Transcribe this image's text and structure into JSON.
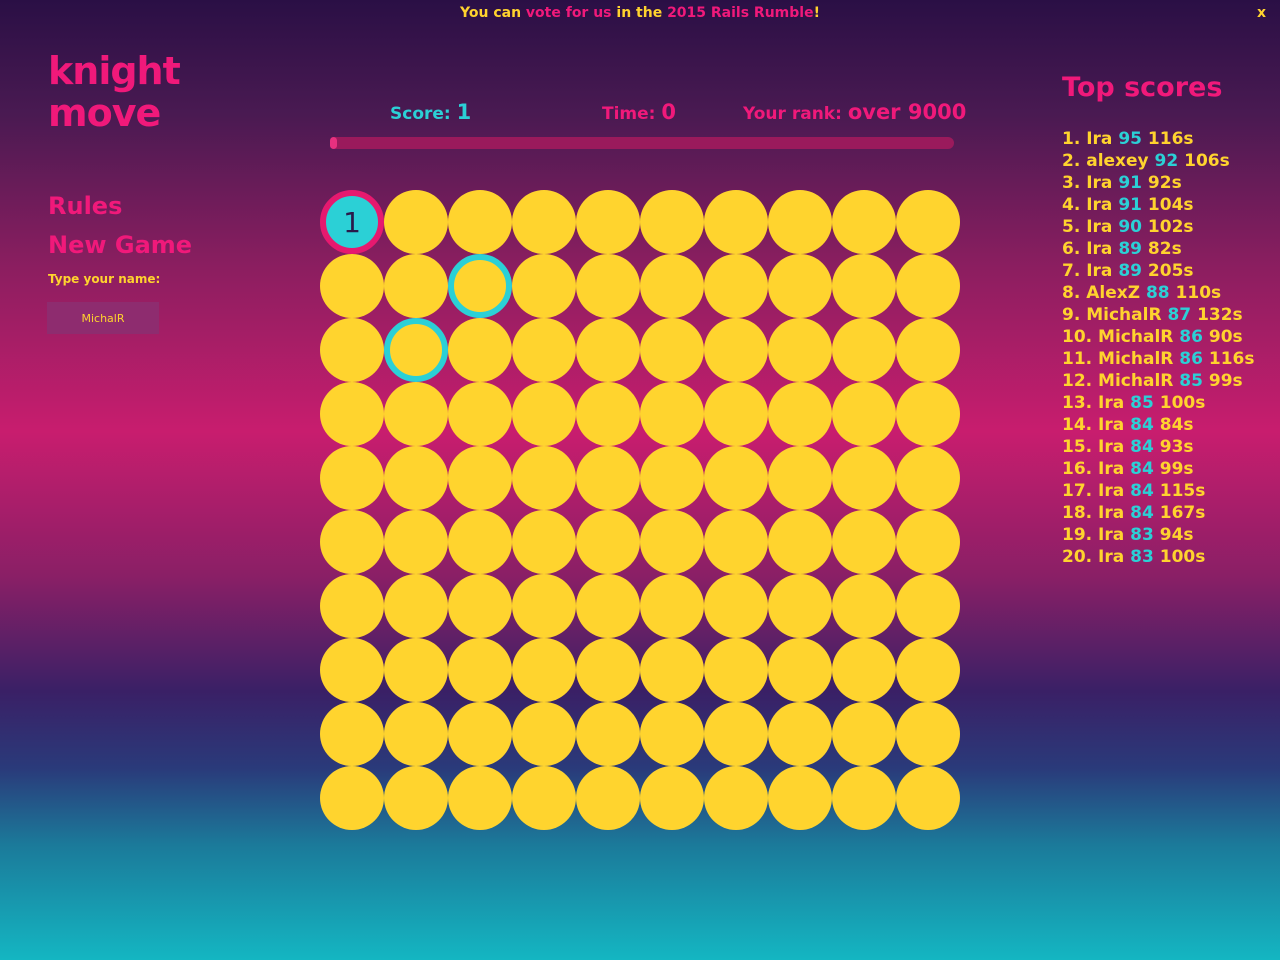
{
  "banner": {
    "part1": "You can ",
    "link1": "vote for us",
    "part2": " in the ",
    "link2": "2015 Rails Rumble",
    "part3": "!",
    "close": "x"
  },
  "logo": {
    "line1": "knight",
    "line2": "move"
  },
  "menu": {
    "rules": "Rules",
    "new_game": "New Game",
    "name_label": "Type your name:",
    "name_value": "MichalR"
  },
  "stats": {
    "score_label": "Score: ",
    "score_value": "1",
    "time_label": "Time: ",
    "time_value": "0",
    "rank_label": "Your rank: ",
    "rank_value": "over 9000",
    "progress_percent": 1
  },
  "board": {
    "size": 10,
    "current": {
      "row": 0,
      "col": 0,
      "label": "1"
    },
    "available": [
      {
        "row": 1,
        "col": 2
      },
      {
        "row": 2,
        "col": 1
      }
    ]
  },
  "top_scores": {
    "title": "Top scores",
    "entries": [
      {
        "rank": "1.",
        "name": "Ira",
        "score": "95",
        "time": "116s"
      },
      {
        "rank": "2.",
        "name": "alexey",
        "score": "92",
        "time": "106s"
      },
      {
        "rank": "3.",
        "name": "Ira",
        "score": "91",
        "time": "92s"
      },
      {
        "rank": "4.",
        "name": "Ira",
        "score": "91",
        "time": "104s"
      },
      {
        "rank": "5.",
        "name": "Ira",
        "score": "90",
        "time": "102s"
      },
      {
        "rank": "6.",
        "name": "Ira",
        "score": "89",
        "time": "82s"
      },
      {
        "rank": "7.",
        "name": "Ira",
        "score": "89",
        "time": "205s"
      },
      {
        "rank": "8.",
        "name": "AlexZ",
        "score": "88",
        "time": "110s"
      },
      {
        "rank": "9.",
        "name": "MichalR",
        "score": "87",
        "time": "132s"
      },
      {
        "rank": "10.",
        "name": "MichalR",
        "score": "86",
        "time": "90s"
      },
      {
        "rank": "11.",
        "name": "MichalR",
        "score": "86",
        "time": "116s"
      },
      {
        "rank": "12.",
        "name": "MichalR",
        "score": "85",
        "time": "99s"
      },
      {
        "rank": "13.",
        "name": "Ira",
        "score": "85",
        "time": "100s"
      },
      {
        "rank": "14.",
        "name": "Ira",
        "score": "84",
        "time": "84s"
      },
      {
        "rank": "15.",
        "name": "Ira",
        "score": "84",
        "time": "93s"
      },
      {
        "rank": "16.",
        "name": "Ira",
        "score": "84",
        "time": "99s"
      },
      {
        "rank": "17.",
        "name": "Ira",
        "score": "84",
        "time": "115s"
      },
      {
        "rank": "18.",
        "name": "Ira",
        "score": "84",
        "time": "167s"
      },
      {
        "rank": "19.",
        "name": "Ira",
        "score": "83",
        "time": "94s"
      },
      {
        "rank": "20.",
        "name": "Ira",
        "score": "83",
        "time": "100s"
      }
    ]
  },
  "colors": {
    "pink": "#f0197a",
    "yellow": "#ffd32e",
    "cyan": "#2bd0d6"
  }
}
